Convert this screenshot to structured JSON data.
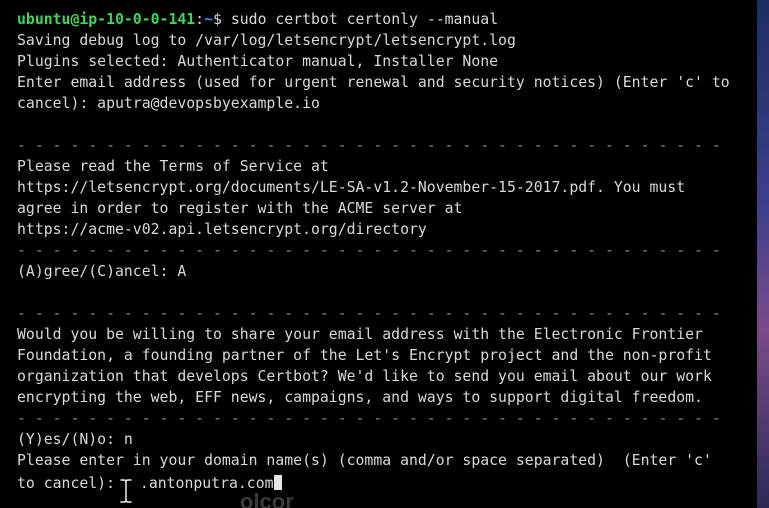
{
  "prompt": {
    "user_host": "ubuntu@ip-10-0-0-141",
    "separator": ":",
    "path": "~",
    "symbol": "$ ",
    "command": "sudo certbot certonly --manual"
  },
  "lines": [
    "Saving debug log to /var/log/letsencrypt/letsencrypt.log",
    "Plugins selected: Authenticator manual, Installer None",
    "Enter email address (used for urgent renewal and security notices) (Enter 'c' to",
    "cancel): aputra@devopsbyexample.io",
    "",
    "- - - - - - - - - - - - - - - - - - - - - - - - - - - - - - - - - - - - - - - -",
    "Please read the Terms of Service at",
    "https://letsencrypt.org/documents/LE-SA-v1.2-November-15-2017.pdf. You must",
    "agree in order to register with the ACME server at",
    "https://acme-v02.api.letsencrypt.org/directory",
    "- - - - - - - - - - - - - - - - - - - - - - - - - - - - - - - - - - - - - - - -",
    "(A)gree/(C)ancel: A",
    "",
    "- - - - - - - - - - - - - - - - - - - - - - - - - - - - - - - - - - - - - - - -",
    "Would you be willing to share your email address with the Electronic Frontier",
    "Foundation, a founding partner of the Let's Encrypt project and the non-profit",
    "organization that develops Certbot? We'd like to send you email about our work",
    "encrypting the web, EFF news, campaigns, and ways to support digital freedom.",
    "- - - - - - - - - - - - - - - - - - - - - - - - - - - - - - - - - - - - - - - -",
    "(Y)es/(N)o: n",
    "Please enter in your domain name(s) (comma and/or space separated)  (Enter 'c'"
  ],
  "last_line_prefix": "to cancel): ",
  "last_line_input": ".antonputra.com",
  "overlay_text": "olcor",
  "colors": {
    "background": "#000000",
    "text": "#d9d9d9",
    "user_host": "#3fd45a",
    "path": "#4a8cf7",
    "cursor": "#e6e6e6"
  },
  "icons": {
    "mouse_pointer": "i-beam-cursor-icon",
    "text_cursor": "block-cursor-icon"
  }
}
